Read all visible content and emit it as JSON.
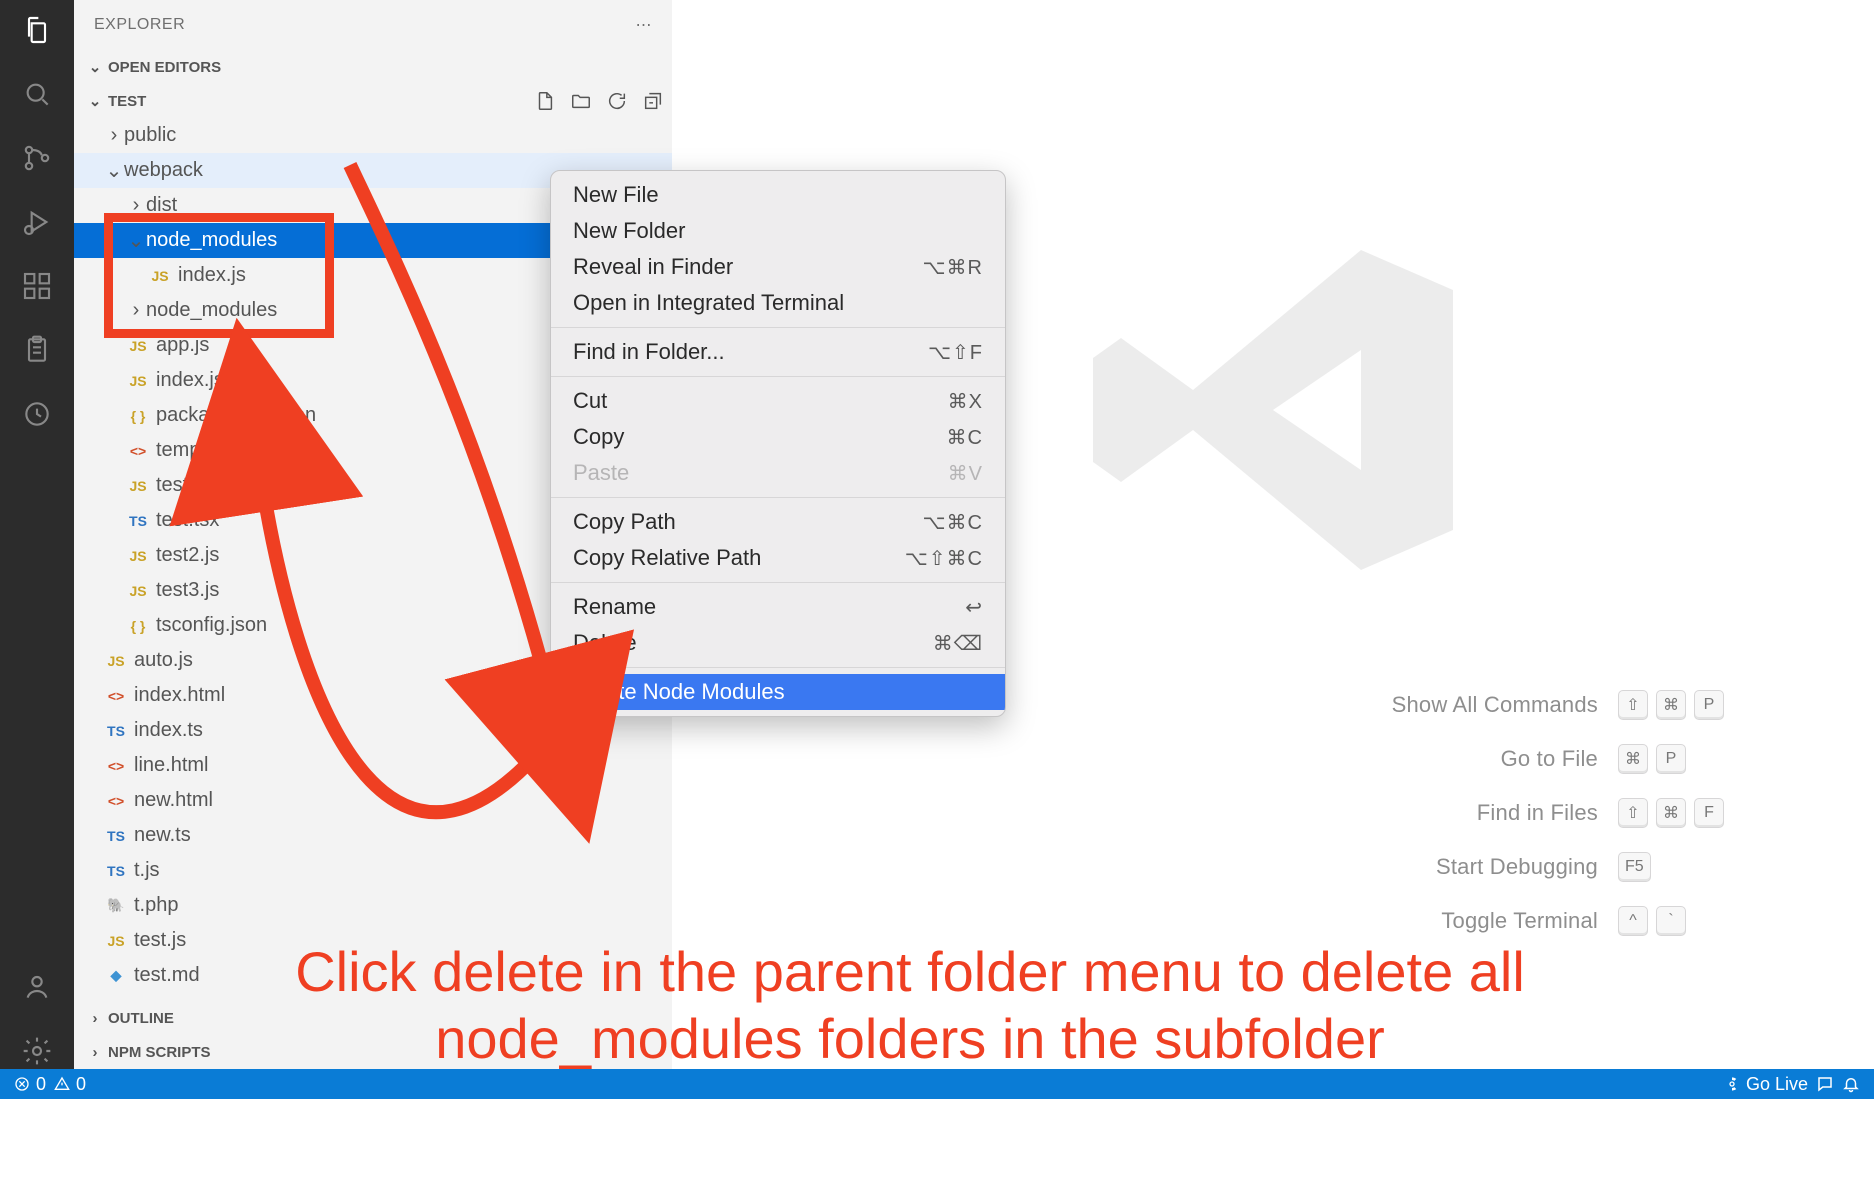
{
  "scale": 1.366,
  "header": {
    "title": "EXPLORER"
  },
  "sections": {
    "openEditors": "OPEN EDITORS",
    "outline": "OUTLINE",
    "npmScripts": "NPM SCRIPTS",
    "workspace": "TEST"
  },
  "tree": [
    {
      "indent": 1,
      "kind": "folder",
      "open": false,
      "name": "public"
    },
    {
      "indent": 1,
      "kind": "folder",
      "open": true,
      "name": "webpack",
      "hl": true
    },
    {
      "indent": 2,
      "kind": "folder",
      "open": false,
      "name": "dist"
    },
    {
      "indent": 2,
      "kind": "folder",
      "open": true,
      "name": "node_modules",
      "sel": true,
      "boxed": true
    },
    {
      "indent": 3,
      "kind": "file",
      "icon": "js",
      "name": "index.js",
      "boxed": true
    },
    {
      "indent": 2,
      "kind": "folder",
      "open": false,
      "name": "node_modules",
      "boxed": true
    },
    {
      "indent": 2,
      "kind": "file",
      "icon": "js",
      "name": "app.js"
    },
    {
      "indent": 2,
      "kind": "file",
      "icon": "js",
      "name": "index.js"
    },
    {
      "indent": 2,
      "kind": "file",
      "icon": "json",
      "name": "package-lock.json"
    },
    {
      "indent": 2,
      "kind": "file",
      "icon": "html",
      "name": "template.html"
    },
    {
      "indent": 2,
      "kind": "file",
      "icon": "js",
      "name": "test.js"
    },
    {
      "indent": 2,
      "kind": "file",
      "icon": "ts",
      "name": "test.tsx"
    },
    {
      "indent": 2,
      "kind": "file",
      "icon": "js",
      "name": "test2.js"
    },
    {
      "indent": 2,
      "kind": "file",
      "icon": "js",
      "name": "test3.js"
    },
    {
      "indent": 2,
      "kind": "file",
      "icon": "json",
      "name": "tsconfig.json"
    },
    {
      "indent": 1,
      "kind": "file",
      "icon": "js",
      "name": "auto.js"
    },
    {
      "indent": 1,
      "kind": "file",
      "icon": "html",
      "name": "index.html"
    },
    {
      "indent": 1,
      "kind": "file",
      "icon": "ts",
      "name": "index.ts"
    },
    {
      "indent": 1,
      "kind": "file",
      "icon": "html",
      "name": "line.html"
    },
    {
      "indent": 1,
      "kind": "file",
      "icon": "html",
      "name": "new.html"
    },
    {
      "indent": 1,
      "kind": "file",
      "icon": "ts",
      "name": "new.ts"
    },
    {
      "indent": 1,
      "kind": "file",
      "icon": "ts",
      "name": "t.js"
    },
    {
      "indent": 1,
      "kind": "file",
      "icon": "php",
      "name": "t.php"
    },
    {
      "indent": 1,
      "kind": "file",
      "icon": "js",
      "name": "test.js"
    },
    {
      "indent": 1,
      "kind": "file",
      "icon": "md",
      "name": "test.md"
    }
  ],
  "contextMenu": {
    "groups": [
      [
        {
          "label": "New File"
        },
        {
          "label": "New Folder"
        },
        {
          "label": "Reveal in Finder",
          "shortcut": "⌥⌘R"
        },
        {
          "label": "Open in Integrated Terminal"
        }
      ],
      [
        {
          "label": "Find in Folder...",
          "shortcut": "⌥⇧F"
        }
      ],
      [
        {
          "label": "Cut",
          "shortcut": "⌘X"
        },
        {
          "label": "Copy",
          "shortcut": "⌘C"
        },
        {
          "label": "Paste",
          "shortcut": "⌘V",
          "disabled": true
        }
      ],
      [
        {
          "label": "Copy Path",
          "shortcut": "⌥⌘C"
        },
        {
          "label": "Copy Relative Path",
          "shortcut": "⌥⇧⌘C"
        }
      ],
      [
        {
          "label": "Rename",
          "shortcut": "↩"
        },
        {
          "label": "Delete",
          "shortcut": "⌘⌫"
        }
      ],
      [
        {
          "label": "Delete Node Modules",
          "highlight": true
        }
      ]
    ]
  },
  "welcome": [
    {
      "label": "Show All Commands",
      "keys": [
        "⇧",
        "⌘",
        "P"
      ]
    },
    {
      "label": "Go to File",
      "keys": [
        "⌘",
        "P"
      ]
    },
    {
      "label": "Find in Files",
      "keys": [
        "⇧",
        "⌘",
        "F"
      ]
    },
    {
      "label": "Start Debugging",
      "keys": [
        "F5"
      ]
    },
    {
      "label": "Toggle Terminal",
      "keys": [
        "^",
        "`"
      ]
    }
  ],
  "status": {
    "errors": "0",
    "warnings": "0",
    "goLive": "Go Live"
  },
  "annotation": {
    "line1": "Click delete in the parent folder menu to delete all",
    "line2": "node_modules folders in the subfolder"
  }
}
